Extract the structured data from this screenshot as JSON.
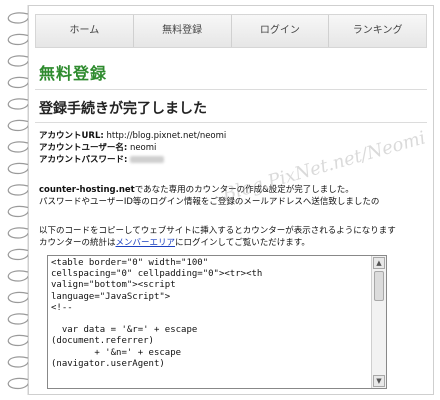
{
  "nav": {
    "items": [
      {
        "label": "ホーム"
      },
      {
        "label": "無料登録"
      },
      {
        "label": "ログイン"
      },
      {
        "label": "ランキング"
      }
    ]
  },
  "header": {
    "title": "無料登録",
    "subtitle": "登録手続きが完了しました"
  },
  "account": {
    "url_label": "アカウントURL:",
    "url_value": "http://blog.pixnet.net/neomi",
    "user_label": "アカウントユーザー名:",
    "user_value": "neomi",
    "password_label": "アカウントパスワード:"
  },
  "messages": {
    "site_name": "counter-hosting.net",
    "complete_text": "であなた専用のカウンターの作成&設定が完了しました。",
    "mail_text": "パスワードやユーザーID等のログイン情報をご登録のメールアドレスへ送信致しましたの",
    "instruction_line1": "以下のコードをコピーしてウェブサイトに挿入するとカウンターが表示されるようになります",
    "instruction_line2_before": "カウンターの統計は",
    "member_link": "メンバーエリア",
    "instruction_line2_after": "にログインしてご覧いただけます。"
  },
  "code": {
    "text": "<table border=\"0\" width=\"100\"\ncellspacing=\"0\" cellpadding=\"0\"><tr><th\nvalign=\"bottom\"><script\nlanguage=\"JavaScript\">\n<!--\n\n  var data = '&r=' + escape\n(document.referrer)\n        + '&n=' + escape\n(navigator.userAgent)"
  },
  "watermark": {
    "text": "Blog.PixNet.net/Neomi"
  },
  "colors": {
    "heading_green": "#2e8b2e",
    "link_blue": "#1a3fbf"
  }
}
